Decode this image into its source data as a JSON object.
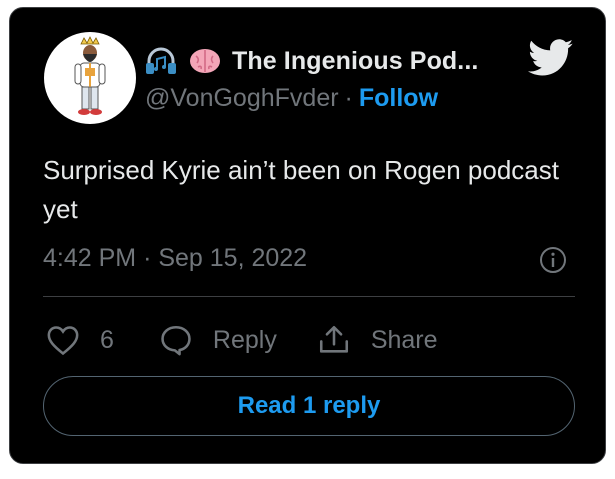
{
  "author": {
    "display_name": "The Ingenious Pod...",
    "handle": "@VonGoghFvder",
    "name_emojis": [
      "headphones-icon",
      "brain-icon"
    ],
    "avatar_icon": "cartoon-king-avatar"
  },
  "header": {
    "separator": "·",
    "follow_label": "Follow",
    "logo_icon": "twitter-bird-icon"
  },
  "tweet": {
    "text": "Surprised Kyrie ain’t been on Rogen podcast yet",
    "time": "4:42 PM",
    "separator": "·",
    "date": "Sep 15, 2022",
    "info_icon": "info-icon"
  },
  "actions": {
    "like_icon": "heart-icon",
    "like_count": "6",
    "reply_icon": "reply-bubble-icon",
    "reply_label": "Reply",
    "share_icon": "share-icon",
    "share_label": "Share"
  },
  "footer": {
    "read_replies_label": "Read 1 reply"
  },
  "colors": {
    "background": "#000000",
    "text": "#e7e9ea",
    "muted": "#71767b",
    "accent": "#1d9bf0",
    "border": "#3d3f42"
  }
}
